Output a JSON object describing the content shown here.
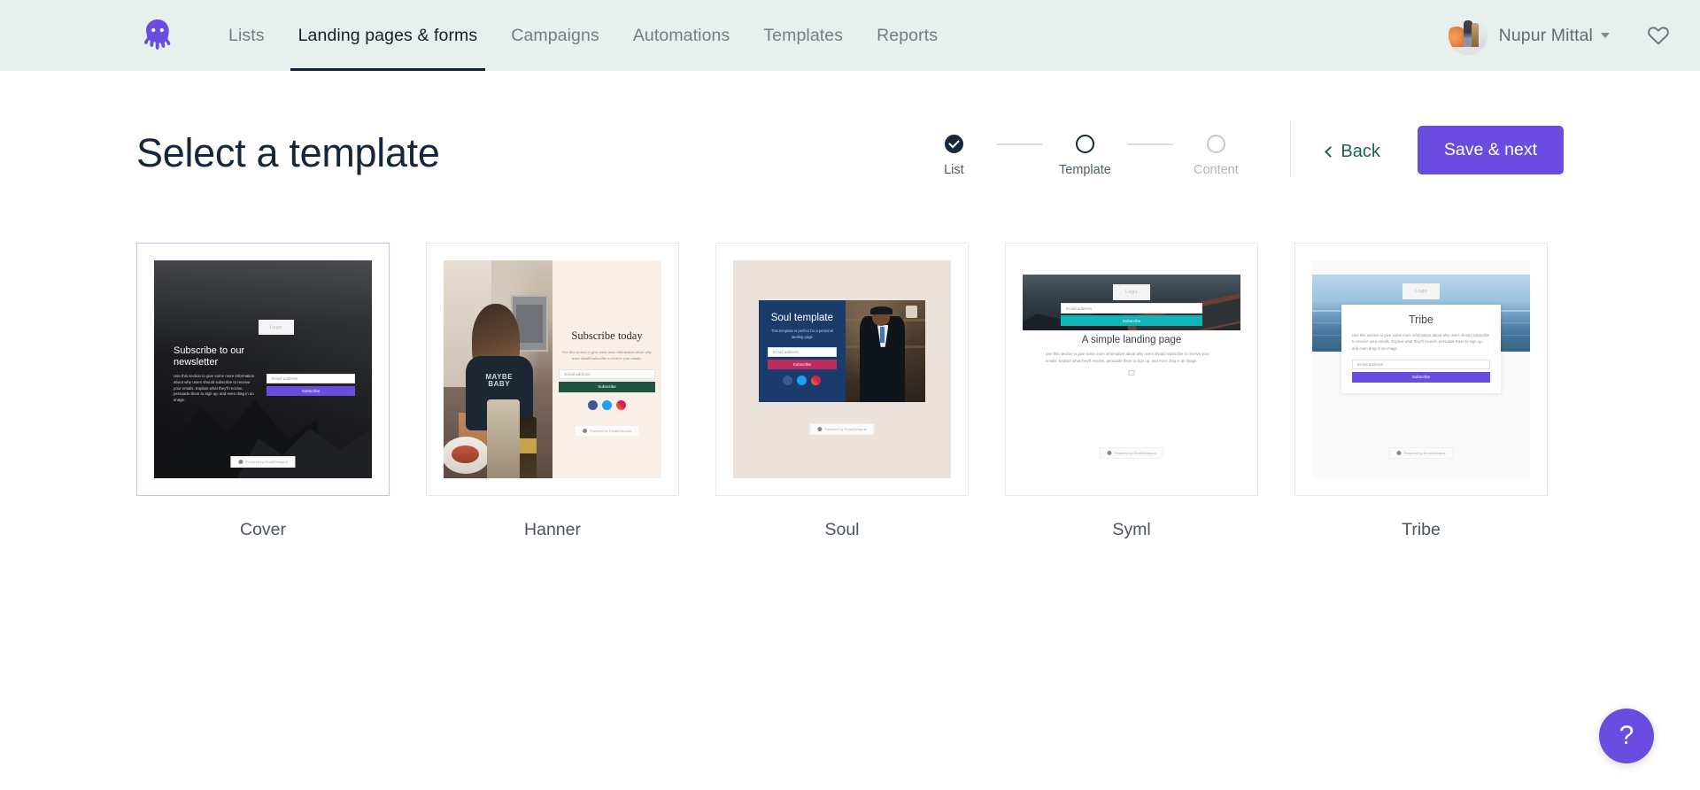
{
  "header": {
    "logo_name": "octopus-logo",
    "nav": [
      {
        "label": "Lists",
        "active": false
      },
      {
        "label": "Landing pages & forms",
        "active": true
      },
      {
        "label": "Campaigns",
        "active": false
      },
      {
        "label": "Automations",
        "active": false
      },
      {
        "label": "Templates",
        "active": false
      },
      {
        "label": "Reports",
        "active": false
      }
    ],
    "user_name": "Nupur Mittal",
    "favourites_icon": "heart-icon",
    "bg_color": "#e7f0ed"
  },
  "page": {
    "title": "Select a template"
  },
  "stepper": {
    "steps": [
      {
        "label": "List",
        "state": "done"
      },
      {
        "label": "Template",
        "state": "active"
      },
      {
        "label": "Content",
        "state": "todo"
      }
    ]
  },
  "actions": {
    "back_label": "Back",
    "save_label": "Save & next",
    "save_color": "#6b4ce0",
    "back_color": "#1c6055"
  },
  "templates": [
    {
      "name": "Cover",
      "selected": true,
      "heading": "Subscribe to our newsletter",
      "body": "Use this section to give some more information about why users should subscribe to receive your emails. Explain what they'll receive, persuade them to sign up, and even drag in an image.",
      "logo_label": "Logo",
      "email_placeholder": "Email address",
      "button_label": "Subscribe",
      "button_color": "#6b4ce0",
      "powered_by": "Powered by EmailOctopus"
    },
    {
      "name": "Hanner",
      "selected": false,
      "heading": "Subscribe today",
      "body": "Use this section to give some more information about why users should subscribe to receive your emails.",
      "photo_text": "MAYBE BABY",
      "email_placeholder": "Email address",
      "button_label": "Subscribe",
      "button_color": "#1e5641",
      "powered_by": "Powered by EmailOctopus"
    },
    {
      "name": "Soul",
      "selected": false,
      "heading": "Soul template",
      "body": "This template is perfect for a personal landing page",
      "email_placeholder": "Email address",
      "button_label": "Subscribe",
      "button_color": "#bd2c5e",
      "powered_by": "Powered by EmailOctopus"
    },
    {
      "name": "Syml",
      "selected": false,
      "heading": "A simple landing page",
      "body": "Use this section to give some more information about why users should subscribe to receive your emails. Explain what they'll receive, persuade them to sign up, and even drag in an image.",
      "logo_label": "Logo",
      "email_placeholder": "Email address",
      "button_label": "Subscribe",
      "button_color": "#12b5b5",
      "powered_by": "Powered by EmailOctopus"
    },
    {
      "name": "Tribe",
      "selected": false,
      "heading": "Tribe",
      "body": "Use this section to give some more information about why users should subscribe to receive your emails. Explain what they'll receive, persuade them to sign up, and even drag in an image.",
      "logo_label": "Logo",
      "email_placeholder": "Email address",
      "button_label": "Subscribe",
      "button_color": "#6b4ce0",
      "powered_by": "Powered by EmailOctopus"
    }
  ],
  "help": {
    "label": "?"
  }
}
